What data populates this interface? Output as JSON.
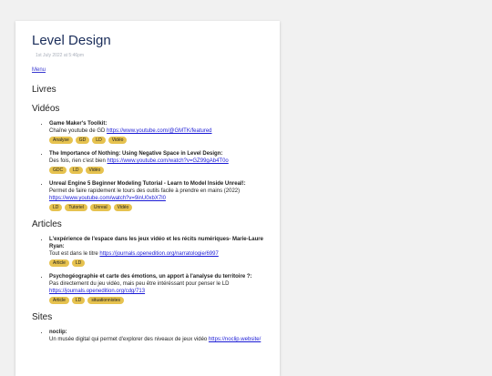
{
  "page": {
    "title": "Level Design",
    "date": "1st July 2022 at 5:46pm",
    "menu": "Menu"
  },
  "sections": {
    "livres": {
      "heading": "Livres"
    },
    "videos": {
      "heading": "Vidéos",
      "items": [
        {
          "title": "Game Maker's Toolkit:",
          "desc": "Chaîne youtube de GD ",
          "link": "https://www.youtube.com/@GMTK/featured",
          "tags": [
            "Analyse",
            "GD",
            "LD",
            "Vidéo"
          ]
        },
        {
          "title": "The Importance of Nothing: Using Negative Space in Level Design:",
          "desc": "Des fois, rien c'est bien ",
          "link": "https://www.youtube.com/watch?v=GZ99gAb4T0o",
          "tags": [
            "GDC",
            "LD",
            "Vidéo"
          ]
        },
        {
          "title": "Unreal Engine 5 Beginner Modeling Tutorial - Learn to Model Inside Unreal!:",
          "desc": "Permet de faire rapidement le tours des outils facile à prendre en mains (2022) ",
          "link": "https://www.youtube.com/watch?v=9inU0xbX7l0",
          "tags": [
            "LD",
            "Tutoriel",
            "Unreal",
            "Vidéo"
          ]
        }
      ]
    },
    "articles": {
      "heading": "Articles",
      "items": [
        {
          "title": "L'expérience de l'espace dans les jeux vidéo et les récits numériques- Marie-Laure Ryan:",
          "desc": "Tout est dans le titre ",
          "link": "https://journals.openedition.org/narratologie/6997",
          "tags": [
            "Article",
            "LD"
          ]
        },
        {
          "title": "Psychogéographie et carte des émotions, un apport à l'analyse du territoire ?:",
          "desc": "Pas directement du jeu vidéo, mais peu être intéréssant pour penser le LD ",
          "link": "https://journals.openedition.org/cdg/713",
          "tags": [
            "Article",
            "LD",
            "situationnistes"
          ]
        }
      ]
    },
    "sites": {
      "heading": "Sites",
      "items": [
        {
          "title": "noclip:",
          "desc": "Un musée digital qui permet d'explorer des niveaux de jeux vidéo ",
          "link": "https://noclip.website/",
          "tags": []
        }
      ]
    }
  },
  "colors": {
    "title": "#1a2d5a",
    "tag_bg": "#e6c24f",
    "link": "#1a1ad6",
    "background": "#f1f1f1"
  }
}
